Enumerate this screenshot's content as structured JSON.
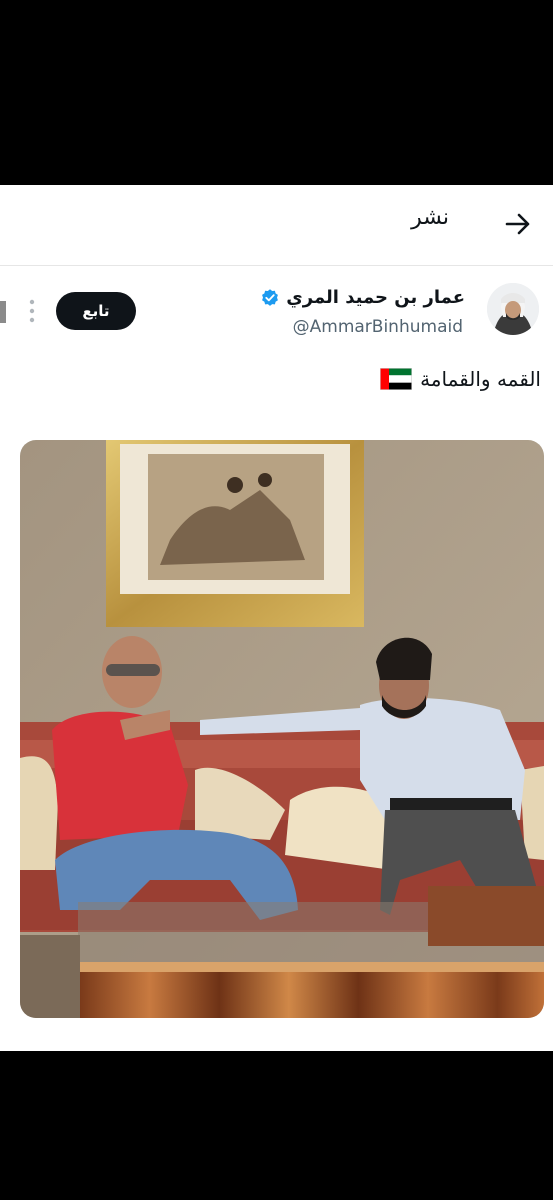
{
  "header": {
    "title": "نشر",
    "back_icon": "arrow-right-icon"
  },
  "tweet": {
    "display_name": "عمار بن حميد المري",
    "verified": true,
    "handle": "@AmmarBinhumaid",
    "follow_label": "تابع",
    "text": "القمه والقمامة",
    "flag_icon": "uae-flag-icon",
    "more_icon": "more-vertical-icon"
  },
  "colors": {
    "text": "#0f1419",
    "secondary": "#536471",
    "verified": "#1d9bf0",
    "button_bg": "#0f1419"
  }
}
